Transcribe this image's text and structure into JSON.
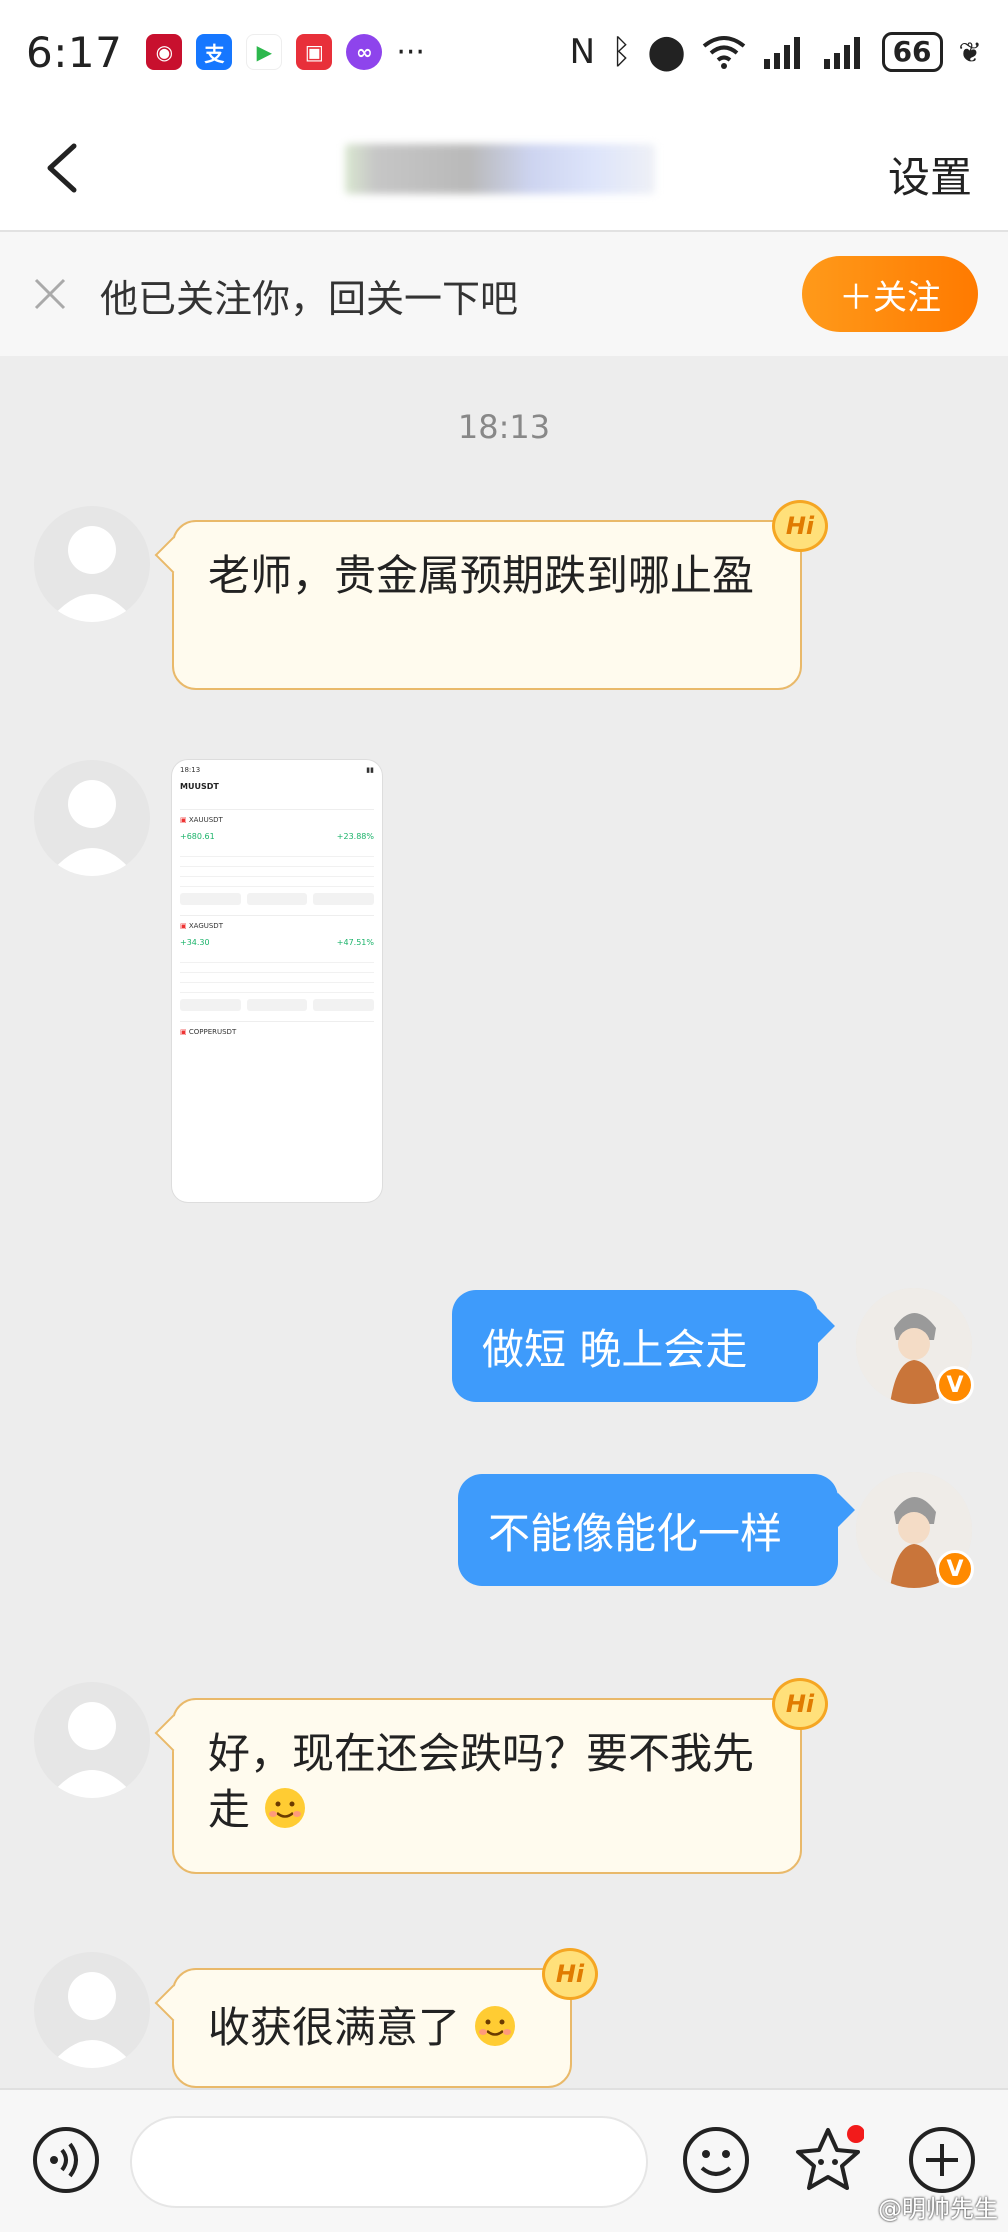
{
  "status_bar": {
    "time": "6:17",
    "more_dots": "···",
    "battery": "66"
  },
  "nav": {
    "settings_label": "设置"
  },
  "follow_bar": {
    "text": "他已关注你，回关一下吧",
    "button_label": "＋关注",
    "button_color": "#ff8a00"
  },
  "chat": {
    "timestamp": "18:13",
    "messages": [
      {
        "side": "left",
        "text": "老师，贵金属预期跌到哪止盈"
      },
      {
        "side": "left",
        "type": "image"
      },
      {
        "side": "right",
        "text": "做短  晚上会走"
      },
      {
        "side": "right",
        "text": "不能像能化一样"
      },
      {
        "side": "left",
        "text": "好，现在还会跌吗？要不我先走"
      },
      {
        "side": "left",
        "text": "收获很满意了"
      }
    ],
    "hi_badge": "Hi",
    "verified_badge": "V",
    "bubble_right_color": "#3e9bfb",
    "bubble_left_color": "#fffbee"
  },
  "screenshot_thumb": {
    "title": "MUUSDT",
    "rows": [
      {
        "name": "XAUUSDT",
        "value": "+680.61",
        "pct": "+23.88%"
      },
      {
        "name": "XAGUSDT",
        "value": "+34.30",
        "pct": "+47.51%"
      },
      {
        "name": "COPPERUSDT",
        "value": "",
        "pct": ""
      }
    ]
  },
  "input_bar": {
    "icons": [
      "voice-icon",
      "emoji-icon",
      "sticker-icon",
      "plus-icon"
    ]
  },
  "watermark": "@明帅先生"
}
